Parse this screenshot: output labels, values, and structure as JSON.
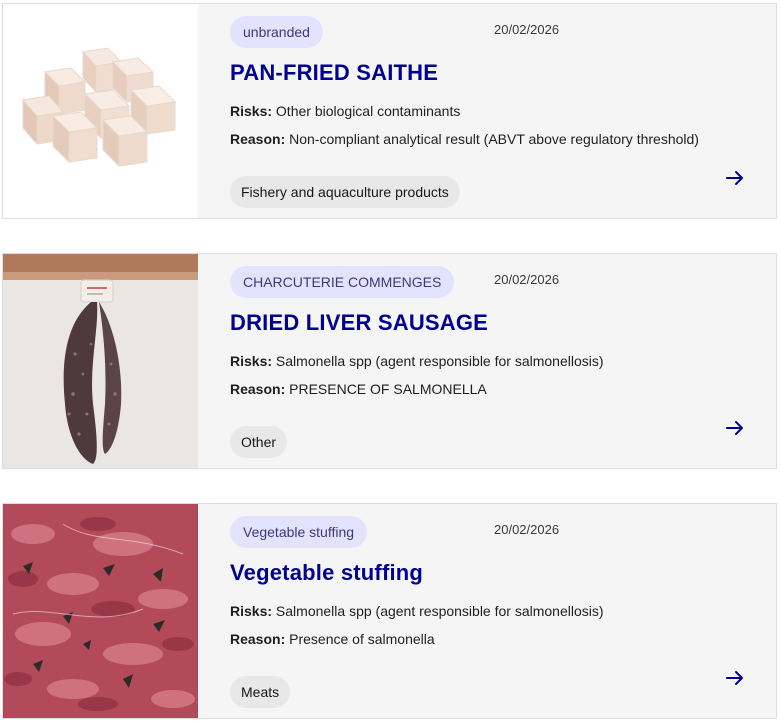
{
  "recalls": [
    {
      "brand": "unbranded",
      "date": "20/02/2026",
      "title": "PAN-FRIED SAITHE",
      "risks_label": "Risks:",
      "risks": "Other biological contaminants",
      "reason_label": "Reason:",
      "reason": "Non-compliant analytical result (ABVT above regulatory threshold)",
      "category": "Fishery and aquaculture products",
      "image_icon": "fish-cubes-photo",
      "arrow_icon": "arrow-right-icon"
    },
    {
      "brand": "CHARCUTERIE COMMENGES",
      "date": "20/02/2026",
      "title": "DRIED LIVER SAUSAGE",
      "risks_label": "Risks:",
      "risks": "Salmonella spp (agent responsible for salmonellosis)",
      "reason_label": "Reason:",
      "reason": "PRESENCE OF SALMONELLA",
      "category": "Other",
      "image_icon": "sausage-photo",
      "arrow_icon": "arrow-right-icon"
    },
    {
      "brand": "Vegetable stuffing",
      "date": "20/02/2026",
      "title": "Vegetable stuffing",
      "risks_label": "Risks:",
      "risks": "Salmonella spp (agent responsible for salmonellosis)",
      "reason_label": "Reason:",
      "reason": "Presence of salmonella",
      "category": "Meats",
      "image_icon": "minced-meat-photo",
      "arrow_icon": "arrow-right-icon"
    }
  ],
  "colors": {
    "title": "#000091",
    "brand_badge_bg": "#e3e3fd",
    "card_bg": "#f5f5f5",
    "category_bg": "#e8e8e8"
  }
}
